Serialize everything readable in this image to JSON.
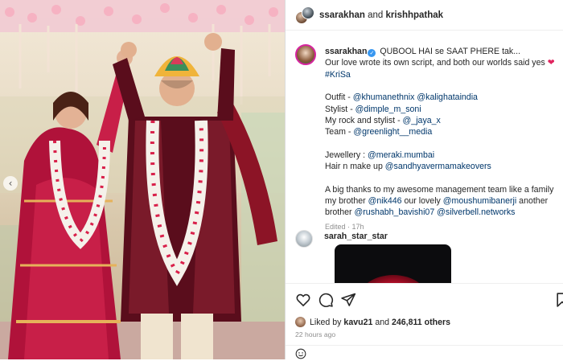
{
  "header": {
    "user1": "ssarakhan",
    "conjunction": "and",
    "user2": "krishhpathak"
  },
  "caption": {
    "username": "ssarakhan",
    "line1": "QUBOOL HAI se SAAT PHERE tak...",
    "line2": "Our love wrote its own script, and both our worlds said yes",
    "heart": "❤",
    "hashtag": "#KriSa",
    "outfit_label": "Outfit - ",
    "outfit_tag1": "@khumanethnix",
    "outfit_tag2": "@kalighataindia",
    "stylist_label": "Stylist - ",
    "stylist_tag": "@dimple_m_soni",
    "rock_label": "My rock and stylist - ",
    "rock_tag": "@_jaya_x",
    "team_label": "Team - ",
    "team_tag": "@greenlight__media",
    "jewellery_label": "Jewellery : ",
    "jewellery_tag": "@meraki.mumbai",
    "hair_label": "Hair n make up ",
    "hair_tag": "@sandhyavermamakeovers",
    "thanks_a": "A big thanks to my awesome management team like a family my brother ",
    "thanks_tag1": "@nik446",
    "thanks_b": " our lovely ",
    "thanks_tag2": "@moushumibanerji",
    "thanks_c": " another brother ",
    "thanks_tag3": "@rushabh_bavishi07",
    "thanks_tag4": "@silverbell.networks",
    "edited": "Edited",
    "age": "17h"
  },
  "comment": {
    "username": "sarah_star_star"
  },
  "likes": {
    "prefix": "Liked by",
    "user": "kavu21",
    "middle": "and",
    "count": "246,811 others"
  },
  "timestamp": "22 hours ago",
  "icons": {
    "like": "heart-outline-icon",
    "comment": "comment-bubble-icon",
    "share": "paper-plane-icon",
    "save": "bookmark-icon",
    "emoji": "smiley-icon",
    "verified": "verified-badge-icon"
  },
  "colors": {
    "link": "#00376b",
    "verified": "#3897f0",
    "meta": "#8e8e8e",
    "heart": "#e0245e"
  }
}
